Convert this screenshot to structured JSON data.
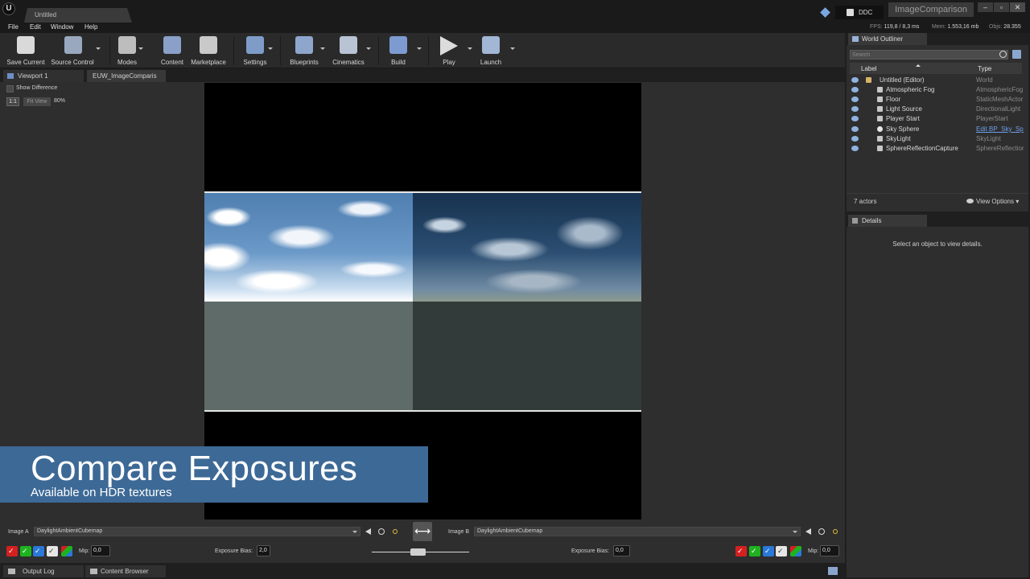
{
  "titlebar": {
    "logo": "U",
    "document_tab": "Untitled",
    "ddc_label": "DDC",
    "project_name": "ImageComparison",
    "window_buttons": [
      "–",
      "▫",
      "✕"
    ]
  },
  "menu": [
    "File",
    "Edit",
    "Window",
    "Help"
  ],
  "stats": {
    "fps_label": "FPS:",
    "fps_value": "119,8",
    "ms_value": "/ 8,3 ms",
    "mem_label": "Mem:",
    "mem_value": "1.553,16 mb",
    "objs_label": "Objs:",
    "objs_value": "28.355"
  },
  "toolbar": {
    "save": "Save Current",
    "source_control": "Source Control",
    "modes": "Modes",
    "content": "Content",
    "marketplace": "Marketplace",
    "settings": "Settings",
    "blueprints": "Blueprints",
    "cinematics": "Cinematics",
    "build": "Build",
    "play": "Play",
    "launch": "Launch"
  },
  "viewport_tabs": [
    "Viewport 1",
    "EUW_ImageComparis"
  ],
  "viewport": {
    "show_difference": "Show Difference",
    "one_to_one": "1:1",
    "fit_view": "Fit View",
    "zoom": "80%"
  },
  "banner": {
    "title": "Compare Exposures",
    "subtitle": "Available on HDR textures"
  },
  "image_a": {
    "label": "Image A",
    "value": "DaylightAmbientCubemap",
    "mip_label": "Mip:",
    "mip": "0,0",
    "exposure_label": "Exposure Bias:",
    "exposure": "2,0"
  },
  "image_b": {
    "label": "Image B",
    "value": "DaylightAmbientCubemap",
    "mip_label": "Mip:",
    "mip": "0,0",
    "exposure_label": "Exposure Bias:",
    "exposure": "0,0"
  },
  "bottom_tabs": [
    "Output Log",
    "Content Browser"
  ],
  "outliner": {
    "tab": "World Outliner",
    "search_placeholder": "Search",
    "col_label": "Label",
    "col_type": "Type",
    "rows": [
      {
        "label": "Untitled (Editor)",
        "type": "World"
      },
      {
        "label": "Atmospheric Fog",
        "type": "AtmosphericFog"
      },
      {
        "label": "Floor",
        "type": "StaticMeshActor"
      },
      {
        "label": "Light Source",
        "type": "DirectionalLight"
      },
      {
        "label": "Player Start",
        "type": "PlayerStart"
      },
      {
        "label": "Sky Sphere",
        "type": "Edit BP_Sky_Sphere"
      },
      {
        "label": "SkyLight",
        "type": "SkyLight"
      },
      {
        "label": "SphereReflectionCapture",
        "type": "SphereReflectionCapture"
      }
    ],
    "actor_count": "7 actors",
    "view_options": "View Options"
  },
  "details": {
    "tab": "Details",
    "message": "Select an object to view details."
  },
  "colors": {
    "banner": "#3d6996",
    "channel_red": "#d42020",
    "channel_green": "#1fb21f",
    "channel_blue": "#2a78d8",
    "link": "#6ea0ea"
  }
}
